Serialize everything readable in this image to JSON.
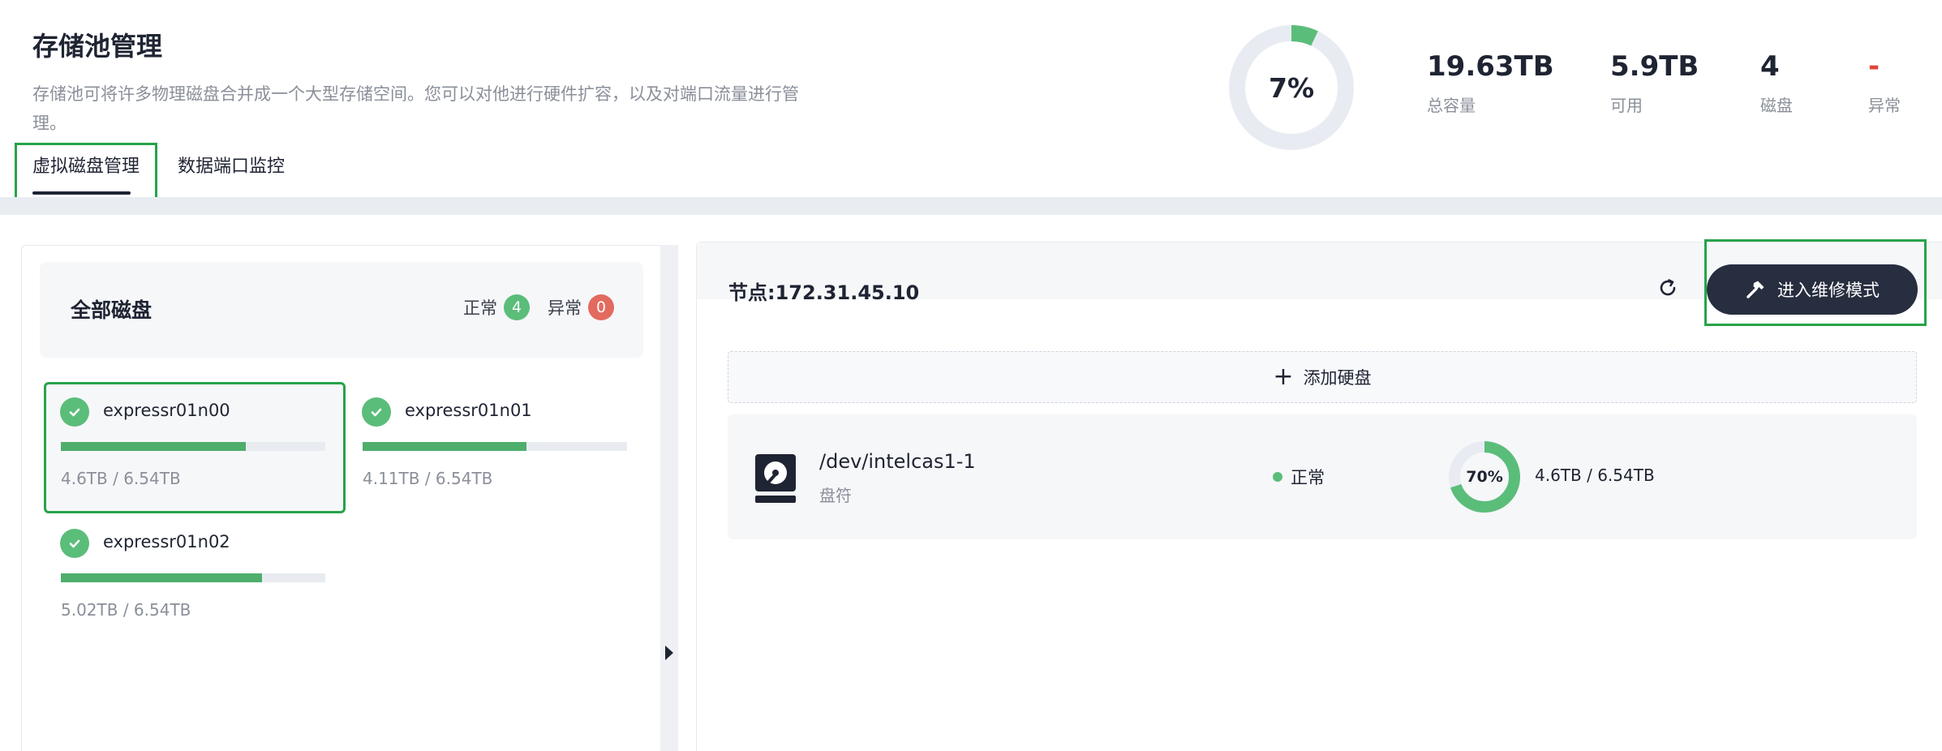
{
  "header": {
    "title": "存储池管理",
    "description": "存储池可将许多物理磁盘合并成一个大型存储空间。您可以对他进行硬件扩容，以及对端口流量进行管理。",
    "tabs": [
      {
        "label": "虚拟磁盘管理",
        "active": true
      },
      {
        "label": "数据端口监控",
        "active": false
      }
    ],
    "usage_percent": 7,
    "usage_label": "7%",
    "stats": [
      {
        "value": "19.63TB",
        "label": "总容量"
      },
      {
        "value": "5.9TB",
        "label": "可用"
      },
      {
        "value": "4",
        "label": "磁盘"
      },
      {
        "value": "-",
        "label": "异常"
      }
    ]
  },
  "sidebar": {
    "title": "全部磁盘",
    "normal_label": "正常",
    "normal_count": "4",
    "abnormal_label": "异常",
    "abnormal_count": "0",
    "disks": [
      {
        "name": "expressr01n00",
        "usage": "4.6TB / 6.54TB",
        "fill": 0.7,
        "selected": true
      },
      {
        "name": "expressr01n01",
        "usage": "4.11TB / 6.54TB",
        "fill": 0.62,
        "selected": false
      },
      {
        "name": "expressr01n02",
        "usage": "5.02TB / 6.54TB",
        "fill": 0.76,
        "selected": false
      }
    ]
  },
  "main": {
    "node_title": "节点:172.31.45.10",
    "maintenance_label": "进入维修模式",
    "add_disk_label": "添加硬盘",
    "disk": {
      "path": "/dev/intelcas1-1",
      "sub_label": "盘符",
      "status": "正常",
      "usage_percent": 70,
      "usage_label": "70%",
      "capacity": "4.6TB / 6.54TB"
    }
  },
  "colors": {
    "accent_green": "#5bbd7a",
    "bar_green": "#4fae6c",
    "danger_red": "#e0463a",
    "dark_button": "#272e3f",
    "highlight_outline": "#27a34a"
  }
}
